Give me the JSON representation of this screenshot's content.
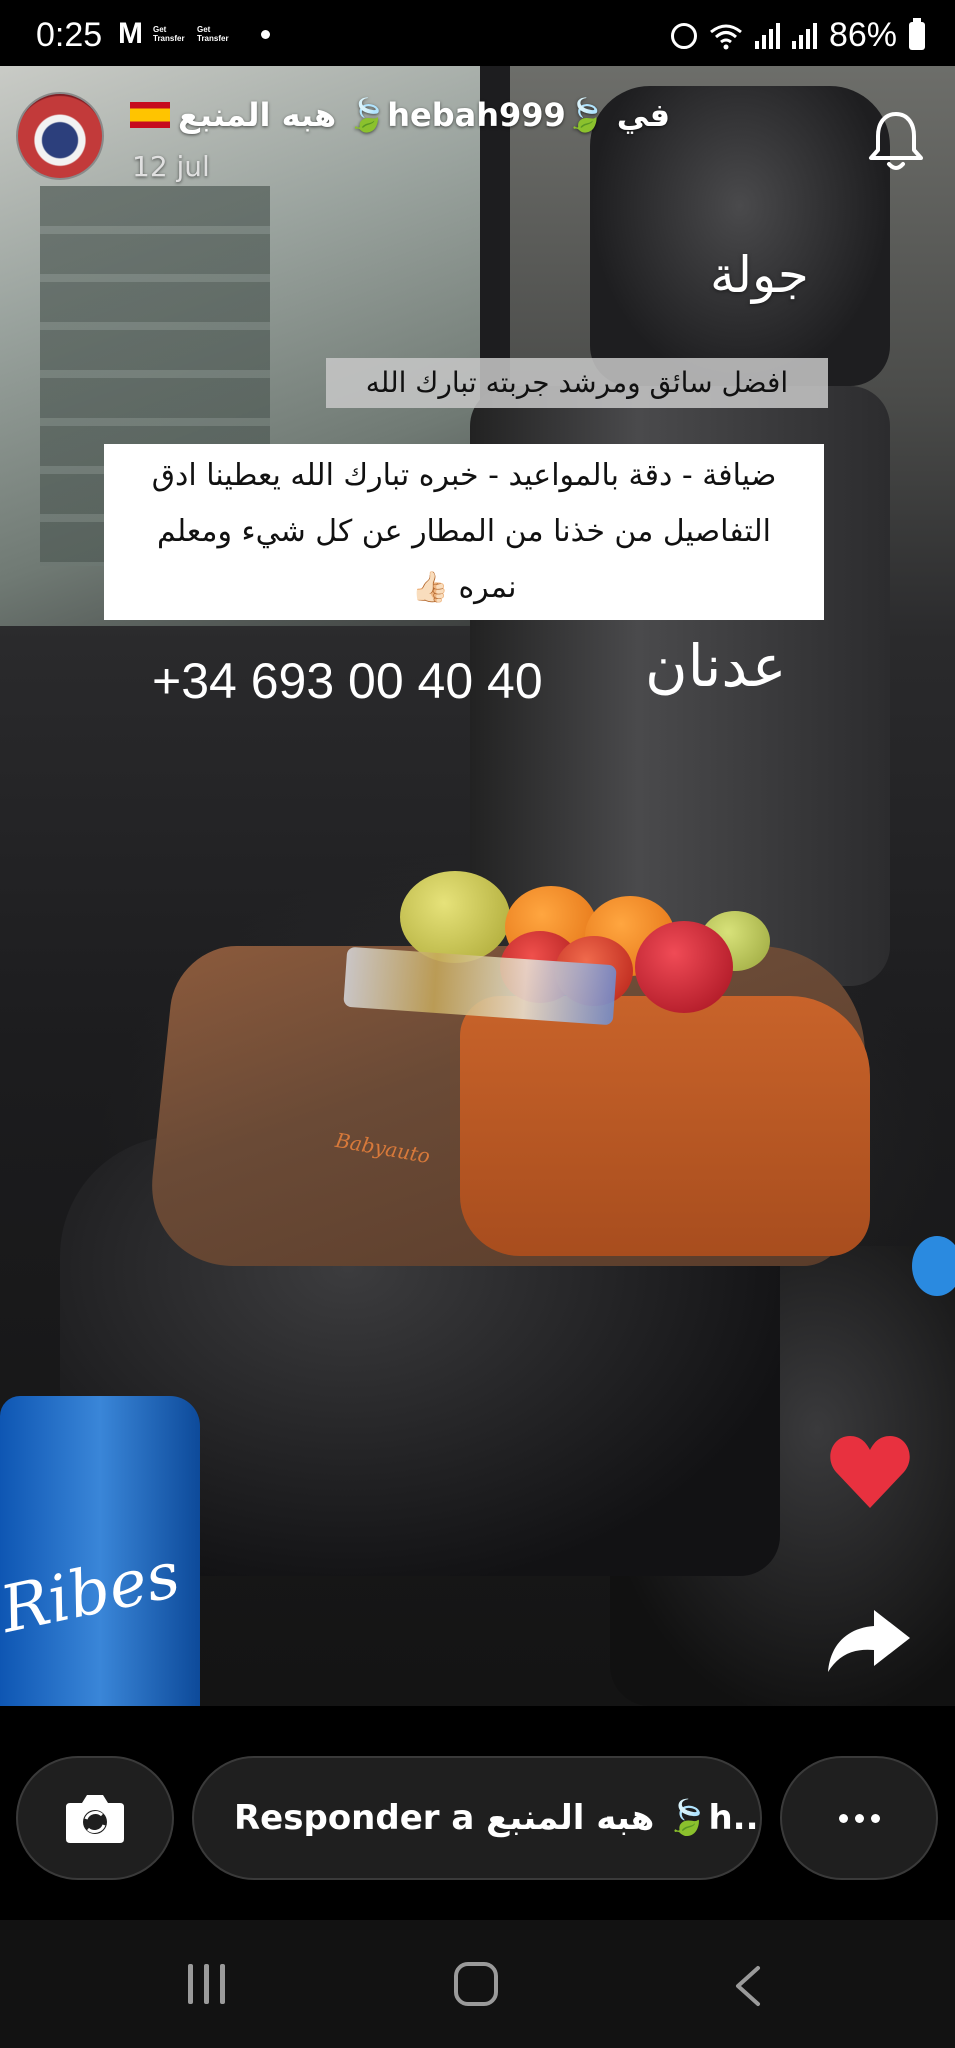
{
  "status_bar": {
    "time": "0:25",
    "gmail_label": "M",
    "get_transfer_label_1": "Get Transfer",
    "get_transfer_label_2": "Get Transfer",
    "battery_percent": "86%"
  },
  "story": {
    "username": "هبه المنبع 🍃hebah999🍃 في",
    "date": "12 jul",
    "caption_tour": "جولة",
    "caption_driver": "افضل سائق ومرشد جربته تبارك الله",
    "caption_review_line1": "ضيافة - دقة بالمواعيد - خبره تبارك الله يعطينا ادق",
    "caption_review_line2": "التفاصيل من خذنا من المطار عن كل شيء ومعلم",
    "caption_review_line3": "نمره 👍🏻",
    "caption_name": "عدنان",
    "caption_phone": "+34 693 00 40 40",
    "booster_brand": "Babyauto",
    "water_brand": "Ribes"
  },
  "reply_bar": {
    "reply_placeholder": "Responder a هبه المنبع 🍃h..."
  },
  "icons": {
    "bell": "bell-icon",
    "heart": "heart-icon",
    "share": "share-icon",
    "camera": "camera-switch-icon",
    "more": "more-dots-icon"
  },
  "colors": {
    "heart": "#e8313f",
    "caption_bg_gray": "#c8c8c8",
    "caption_bg_white": "#ffffff"
  }
}
